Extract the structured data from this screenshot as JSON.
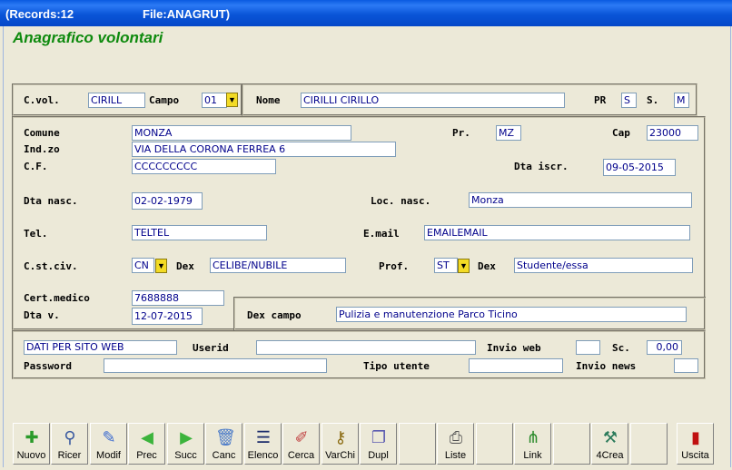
{
  "window": {
    "records": "(Records:12",
    "file": "File:ANAGRUT)"
  },
  "form_title": "Anagrafico volontari",
  "header": {
    "cvol_label": "C.vol.",
    "cvol": "CIRILL",
    "campo_label": "Campo",
    "campo": "01",
    "nome_label": "Nome",
    "nome": "CIRILLI CIRILLO",
    "pr_label": "PR",
    "pr": "S",
    "s_label": "S.",
    "s": "M"
  },
  "details": {
    "comune_label": "Comune",
    "comune": "MONZA",
    "prov_label": "Pr.",
    "prov": "MZ",
    "cap_label": "Cap",
    "cap": "23000",
    "indzo_label": "Ind.zo",
    "indzo": "VIA DELLA CORONA FERREA 6",
    "cf_label": "C.F.",
    "cf": "CCCCCCCCC",
    "dta_iscr_label": "Dta iscr.",
    "dta_iscr": "09-05-2015",
    "dta_nasc_label": "Dta nasc.",
    "dta_nasc": "02-02-1979",
    "loc_nasc_label": "Loc. nasc.",
    "loc_nasc": "Monza",
    "tel_label": "Tel.",
    "tel": "TELTEL",
    "email_label": "E.mail",
    "email": "EMAILEMAIL",
    "cstciv_label": "C.st.civ.",
    "cstciv": "CN",
    "dex1_label": "Dex",
    "dex1": "CELIBE/NUBILE",
    "prof_label": "Prof.",
    "prof": "ST",
    "dex2_label": "Dex",
    "dex2": "Studente/essa",
    "cert_label": "Cert.medico",
    "cert": "7688888",
    "dtav_label": "Dta v.",
    "dtav": "12-07-2015",
    "dexcampo_label": "Dex campo",
    "dexcampo": "Pulizia e manutenzione Parco Ticino"
  },
  "web": {
    "dati": "DATI PER SITO WEB",
    "userid_label": "Userid",
    "userid": "",
    "invio_web_label": "Invio web",
    "invio_web": "",
    "sc_label": "Sc.",
    "sc": "0,00",
    "password_label": "Password",
    "password": "",
    "tipo_utente_label": "Tipo utente",
    "tipo_utente": "",
    "invio_news_label": "Invio news",
    "invio_news": ""
  },
  "toolbar": [
    {
      "label": "Nuovo",
      "icon": "new-record-icon"
    },
    {
      "label": "Ricer",
      "icon": "search-icon"
    },
    {
      "label": "Modif",
      "icon": "edit-icon"
    },
    {
      "label": "Prec",
      "icon": "arrow-left-icon"
    },
    {
      "label": "Succ",
      "icon": "arrow-right-icon"
    },
    {
      "label": "Canc",
      "icon": "trash-icon"
    },
    {
      "label": "Elenco",
      "icon": "list-icon"
    },
    {
      "label": "Cerca",
      "icon": "find-icon"
    },
    {
      "label": "VarChi",
      "icon": "key-icon"
    },
    {
      "label": "Dupl",
      "icon": "duplicate-icon"
    },
    {
      "label": "",
      "icon": ""
    },
    {
      "label": "Liste",
      "icon": "printer-icon"
    },
    {
      "label": "",
      "icon": ""
    },
    {
      "label": "Link",
      "icon": "link-tree-icon"
    },
    {
      "label": "",
      "icon": ""
    },
    {
      "label": "4Crea",
      "icon": "create-icon"
    },
    {
      "label": "",
      "icon": ""
    },
    {
      "label": "Uscita",
      "icon": "exit-door-icon"
    }
  ]
}
